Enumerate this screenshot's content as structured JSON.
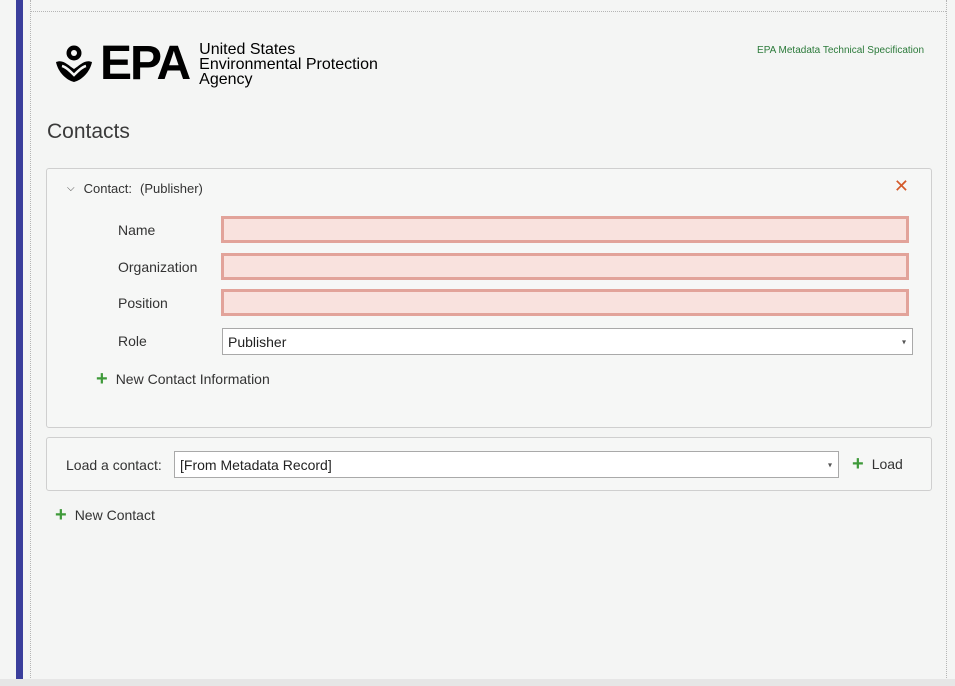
{
  "header": {
    "logo_word": "EPA",
    "agency_lines": [
      "United States",
      "Environmental Protection",
      "Agency"
    ],
    "spec_link": "EPA Metadata Technical Specification"
  },
  "page": {
    "title": "Contacts"
  },
  "contact": {
    "label": "Contact:",
    "role_tag": "(Publisher)",
    "fields": [
      {
        "label": "Name",
        "value": ""
      },
      {
        "label": "Organization",
        "value": ""
      },
      {
        "label": "Position",
        "value": ""
      }
    ],
    "role_label": "Role",
    "role_value": "Publisher",
    "new_info_label": "New Contact Information"
  },
  "load": {
    "label": "Load a contact:",
    "value": "[From Metadata Record]",
    "button": "Load"
  },
  "new_contact_label": "New Contact",
  "colors": {
    "accent_bar": "#3b3f9c",
    "error_fill": "#f9e2de",
    "error_border": "#e2a39a",
    "add_green": "#3f9a3a",
    "close_red": "#d45a2a"
  }
}
